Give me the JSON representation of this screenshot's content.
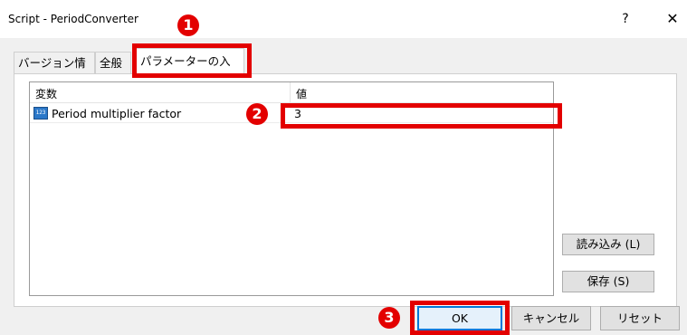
{
  "window": {
    "title": "Script - PeriodConverter",
    "help_glyph": "?",
    "close_glyph": "✕"
  },
  "tabs": [
    {
      "label": "バージョン情報",
      "active": false
    },
    {
      "label": "全般",
      "active": false
    },
    {
      "label": "パラメーターの入力",
      "active": true
    }
  ],
  "grid": {
    "headers": [
      "変数",
      "値"
    ],
    "rows": [
      {
        "icon": "numeric-parameter-icon",
        "icon_text": "123",
        "name": "Period multiplier factor",
        "value": "3"
      }
    ]
  },
  "side_buttons": {
    "load": "読み込み (L)",
    "save": "保存 (S)"
  },
  "bottom_buttons": {
    "ok": "OK",
    "cancel": "キャンセル",
    "reset": "リセット"
  },
  "annotations": {
    "markers": [
      "1",
      "2",
      "3"
    ],
    "color": "#e30000"
  }
}
